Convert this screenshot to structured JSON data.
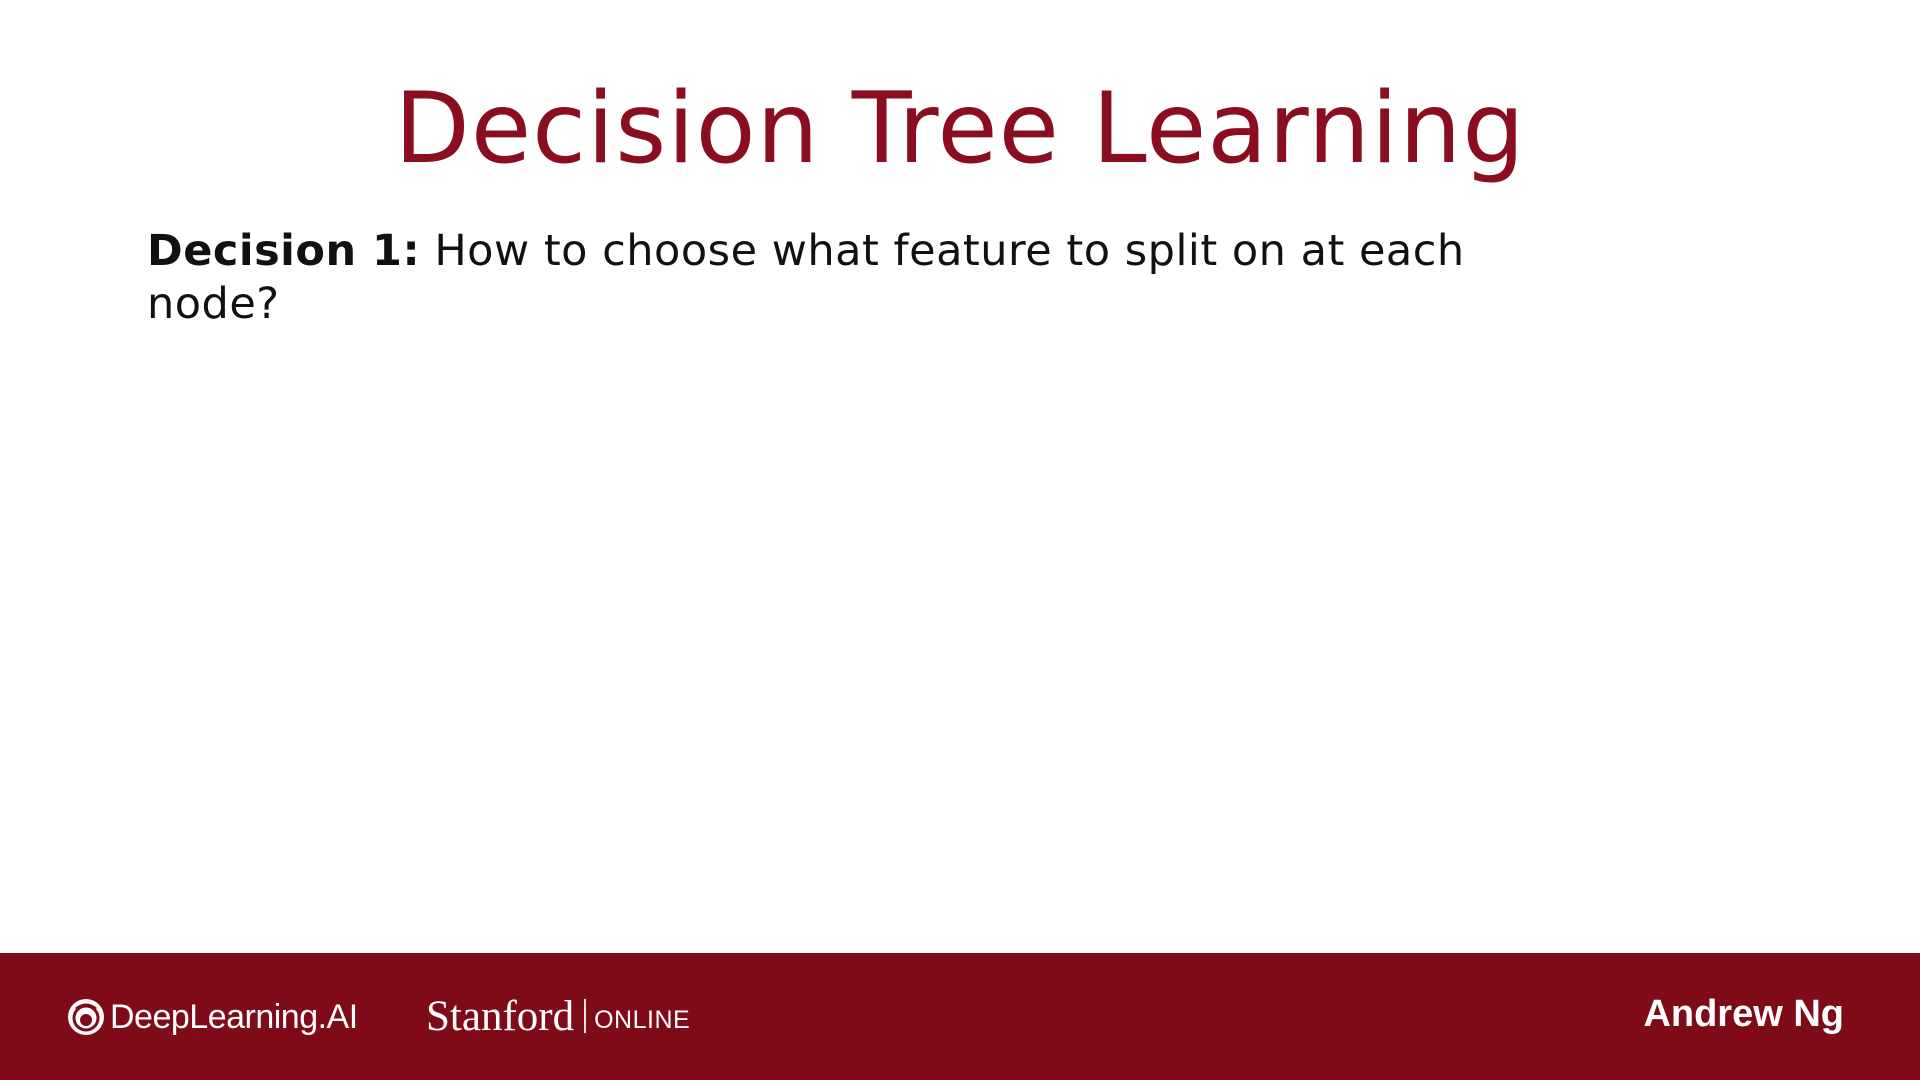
{
  "slide": {
    "title": "Decision Tree Learning",
    "decision_label": "Decision 1:",
    "decision_text": " How to choose what feature to split on at each node?"
  },
  "footer": {
    "deeplearning_logo": "DeepLearning.AI",
    "stanford_logo": "Stanford",
    "stanford_online": "ONLINE",
    "author": "Andrew Ng"
  },
  "colors": {
    "title": "#8a0e1f",
    "footer_background": "#7f0a18",
    "footer_text": "#ffffff",
    "body_text": "#111111"
  },
  "icons": {
    "deeplearning": "deeplearning-ai-logo-icon"
  }
}
